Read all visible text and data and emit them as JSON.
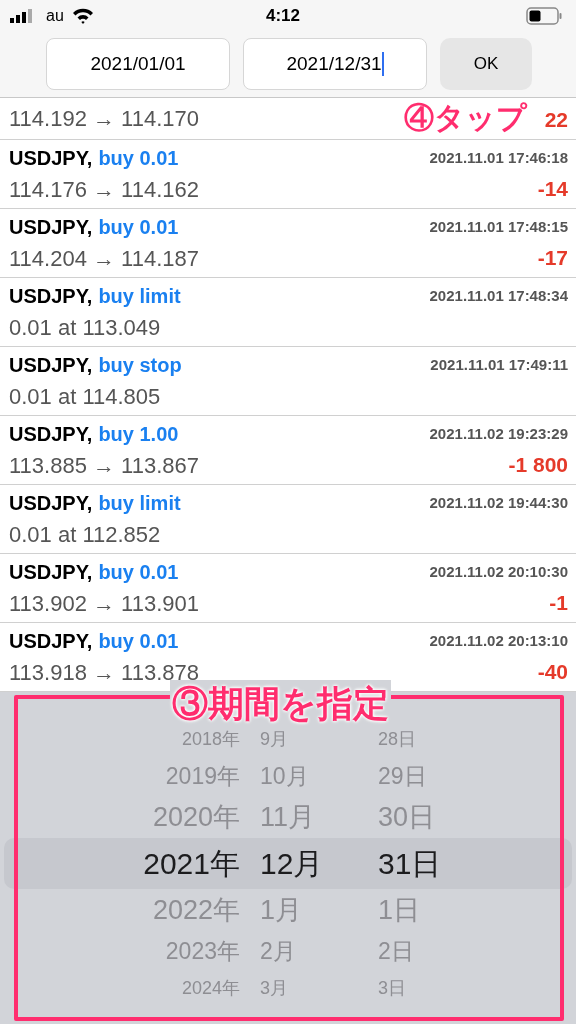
{
  "status_bar": {
    "carrier": "au",
    "time": "4:12"
  },
  "toolbar": {
    "from_date": "2021/01/01",
    "to_date": "2021/12/31",
    "ok_button": "OK"
  },
  "partial_row": {
    "detail": "114.192 → 114.170",
    "pl": "22"
  },
  "rows": [
    {
      "symbol": "USDJPY,",
      "order": "buy 0.01",
      "time": "2021.11.01 17:46:18",
      "detail": "114.176 → 114.162",
      "pl": "-14"
    },
    {
      "symbol": "USDJPY,",
      "order": "buy 0.01",
      "time": "2021.11.01 17:48:15",
      "detail": "114.204 → 114.187",
      "pl": "-17"
    },
    {
      "symbol": "USDJPY,",
      "order": "buy limit",
      "time": "2021.11.01 17:48:34",
      "detail": "0.01 at 113.049"
    },
    {
      "symbol": "USDJPY,",
      "order": "buy stop",
      "time": "2021.11.01 17:49:11",
      "detail": "0.01 at 114.805"
    },
    {
      "symbol": "USDJPY,",
      "order": "buy 1.00",
      "time": "2021.11.02 19:23:29",
      "detail": "113.885 → 113.867",
      "pl": "-1 800"
    },
    {
      "symbol": "USDJPY,",
      "order": "buy limit",
      "time": "2021.11.02 19:44:30",
      "detail": "0.01 at 112.852"
    },
    {
      "symbol": "USDJPY,",
      "order": "buy 0.01",
      "time": "2021.11.02 20:10:30",
      "detail": "113.902 → 113.901",
      "pl": "-1"
    },
    {
      "symbol": "USDJPY,",
      "order": "buy 0.01",
      "time": "2021.11.02 20:13:10",
      "detail": "113.918 → 113.878",
      "pl": "-40"
    }
  ],
  "picker": {
    "rows": [
      {
        "year": "2018年",
        "month": "9月",
        "day": "28日",
        "selected": false
      },
      {
        "year": "2019年",
        "month": "10月",
        "day": "29日",
        "selected": false
      },
      {
        "year": "2020年",
        "month": "11月",
        "day": "30日",
        "selected": false
      },
      {
        "year": "2021年",
        "month": "12月",
        "day": "31日",
        "selected": true
      },
      {
        "year": "2022年",
        "month": "1月",
        "day": "1日",
        "selected": false
      },
      {
        "year": "2023年",
        "month": "2月",
        "day": "2日",
        "selected": false
      },
      {
        "year": "2024年",
        "month": "3月",
        "day": "3日",
        "selected": false
      }
    ]
  },
  "annotations": {
    "tap_label": "④タップ",
    "period_label": "③期間を指定"
  }
}
